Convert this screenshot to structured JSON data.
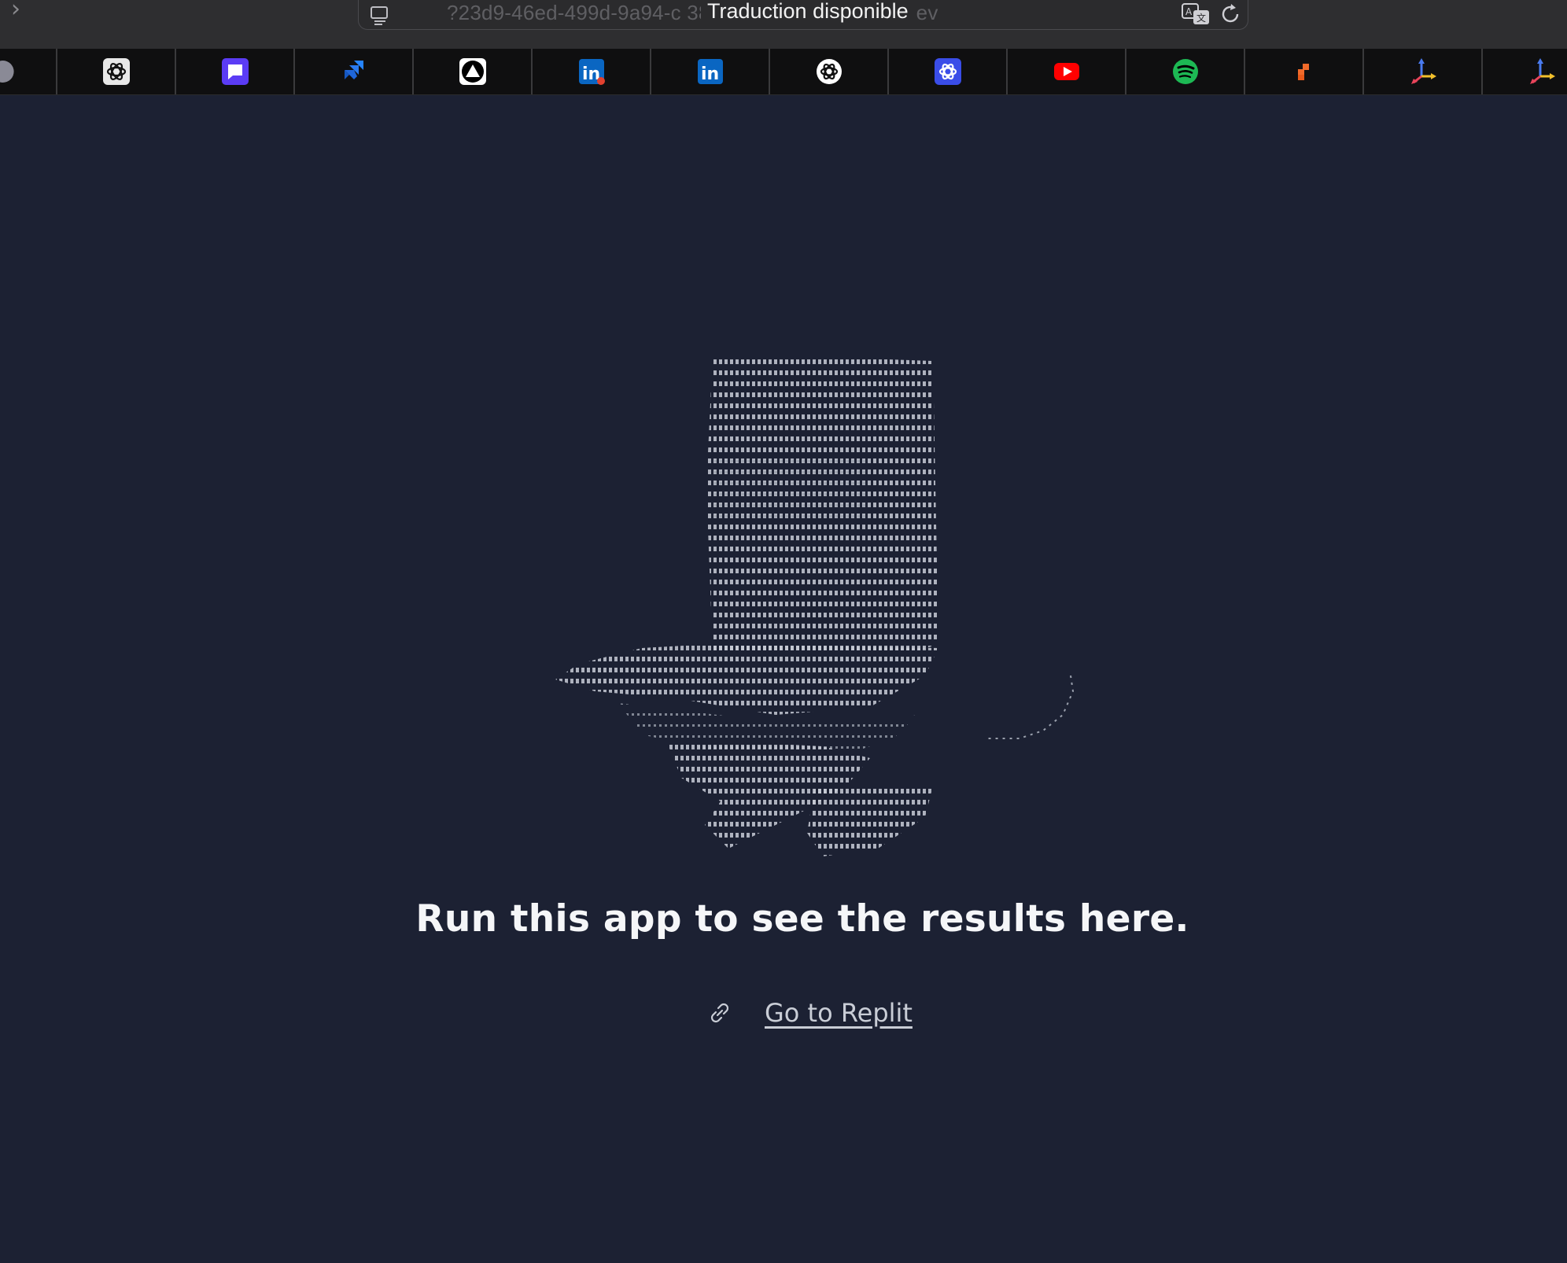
{
  "browser": {
    "url": "?23d9-46ed-499d-9a94-c                              38j2e80ilth.spock.replit.dev",
    "translation_tooltip": "Traduction disponible"
  },
  "favorites": [
    {
      "name": "partial-tab",
      "icon": "circle-icon",
      "color": "#7a7a8a"
    },
    {
      "name": "chatgpt",
      "icon": "openai-icon",
      "color": "#ffffff"
    },
    {
      "name": "chat-app",
      "icon": "chat-bubble-icon",
      "color": "#5b3cf5"
    },
    {
      "name": "jira",
      "icon": "jira-icon",
      "color": "#2684ff"
    },
    {
      "name": "triangle-app",
      "icon": "triangle-icon",
      "color": "#ffffff"
    },
    {
      "name": "linkedin-notify",
      "icon": "linkedin-icon",
      "color": "#0a66c2"
    },
    {
      "name": "linkedin",
      "icon": "linkedin-icon",
      "color": "#0a66c2"
    },
    {
      "name": "openai-white",
      "icon": "openai-icon",
      "color": "#ffffff"
    },
    {
      "name": "openai-blue",
      "icon": "openai-icon",
      "color": "#3a4de8"
    },
    {
      "name": "youtube",
      "icon": "youtube-icon",
      "color": "#ff0000"
    },
    {
      "name": "spotify",
      "icon": "spotify-icon",
      "color": "#1db954"
    },
    {
      "name": "orange-app",
      "icon": "blocks-icon",
      "color": "#f06a2a"
    },
    {
      "name": "axes-app",
      "icon": "axes-icon",
      "color": "#4a7bf0"
    },
    {
      "name": "axes-app-2",
      "icon": "axes-icon",
      "color": "#4a7bf0"
    }
  ],
  "main": {
    "message": "Run this app to see the results here.",
    "link_label": "Go to Replit"
  },
  "colors": {
    "page_bg": "#1c2133",
    "toolbar_bg": "#2e2e30",
    "favbar_bg": "#0f0f10",
    "message_text": "#f5f6f8",
    "link_text": "#c9cdd6"
  }
}
